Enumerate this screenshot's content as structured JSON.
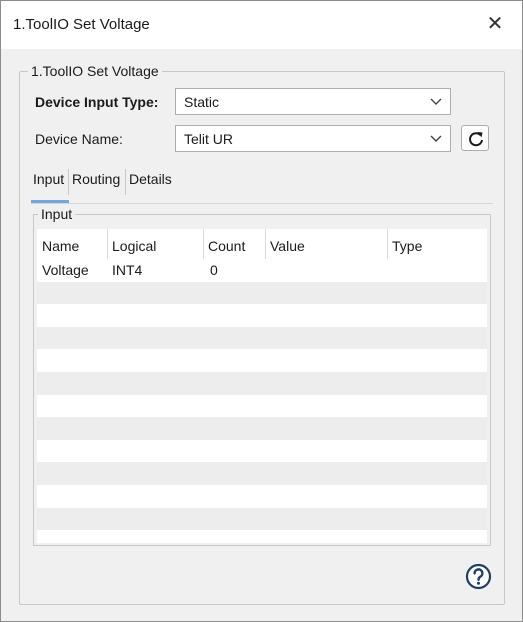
{
  "window": {
    "title": "1.ToolIO Set Voltage",
    "close_glyph": "✕"
  },
  "group": {
    "legend": "1.ToolIO Set Voltage"
  },
  "device_input_type": {
    "label": "Device Input Type:",
    "value": "Static"
  },
  "device_name": {
    "label": "Device Name:",
    "value": "Telit UR"
  },
  "tabs": [
    {
      "label": "Input",
      "selected": true
    },
    {
      "label": "Routing",
      "selected": false
    },
    {
      "label": "Details",
      "selected": false
    }
  ],
  "input_panel": {
    "legend": "Input",
    "columns": [
      "Name",
      "Logical",
      "Count",
      "Value",
      "Type"
    ],
    "rows": [
      {
        "name": "Voltage",
        "logical": "INT4",
        "count": "0",
        "value": "",
        "type": ""
      }
    ]
  },
  "icons": {
    "refresh": "refresh-icon",
    "help": "help-icon",
    "chevron": "chevron-down-icon",
    "close": "close-icon"
  },
  "colors": {
    "accent": "#6fa8dc",
    "dialog_bg": "#f0f0f0",
    "row_alt": "#ededed"
  }
}
